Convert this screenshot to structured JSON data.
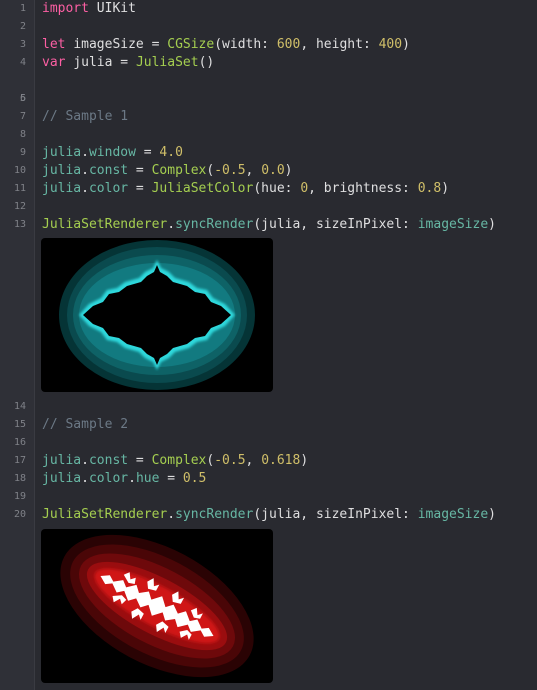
{
  "editor": {
    "lines": [
      {
        "n": "1",
        "top": 0
      },
      {
        "n": "2"
      },
      {
        "n": "3"
      },
      {
        "n": "4"
      },
      {
        "n": "5"
      },
      {
        "n": "6"
      },
      {
        "n": "7"
      },
      {
        "n": "8"
      },
      {
        "n": "9"
      },
      {
        "n": "10"
      },
      {
        "n": "11"
      },
      {
        "n": "12"
      },
      {
        "n": "13"
      },
      {
        "n": "14"
      },
      {
        "n": "15"
      },
      {
        "n": "16"
      },
      {
        "n": "17"
      },
      {
        "n": "18"
      },
      {
        "n": "19"
      },
      {
        "n": "20"
      }
    ]
  },
  "code": {
    "l1": {
      "kw": "import",
      "mod": "UIKit"
    },
    "l3": {
      "kw": "let",
      "name": "imageSize",
      "eq": " = ",
      "type": "CGSize",
      "open": "(width: ",
      "w": "600",
      "mid": ", height: ",
      "h": "400",
      "close": ")"
    },
    "l4": {
      "kw": "var",
      "name": "julia",
      "eq": " = ",
      "type": "JuliaSet",
      "paren": "()"
    },
    "l7": {
      "comment": "// Sample 1"
    },
    "l9": {
      "obj": "julia",
      "dot": ".",
      "prop": "window",
      "eq": " = ",
      "val": "4.0"
    },
    "l10": {
      "obj": "julia",
      "dot": ".",
      "prop": "const",
      "eq": " = ",
      "type": "Complex",
      "open": "(",
      "a": "-0.5",
      "sep": ", ",
      "b": "0.0",
      "close": ")"
    },
    "l11": {
      "obj": "julia",
      "dot": ".",
      "prop": "color",
      "eq": " = ",
      "type": "JuliaSetColor",
      "open": "(hue: ",
      "hue": "0",
      "sep": ", brightness: ",
      "br": "0.8",
      "close": ")"
    },
    "l13": {
      "type": "JuliaSetRenderer",
      "dot": ".",
      "method": "syncRender",
      "open": "(julia, sizeInPixel: ",
      "arg": "imageSize",
      "close": ")"
    },
    "l15": {
      "comment": "// Sample 2"
    },
    "l17": {
      "obj": "julia",
      "dot": ".",
      "prop": "const",
      "eq": " = ",
      "type": "Complex",
      "open": "(",
      "a": "-0.5",
      "sep": ", ",
      "b": "0.618",
      "close": ")"
    },
    "l18": {
      "obj": "julia",
      "dot": ".",
      "prop": "color",
      "dot2": ".",
      "prop2": "hue",
      "eq": " = ",
      "val": "0.5"
    },
    "l20": {
      "type": "JuliaSetRenderer",
      "dot": ".",
      "method": "syncRender",
      "open": "(julia, sizeInPixel: ",
      "arg": "imageSize",
      "close": ")"
    }
  },
  "colors": {
    "background": "#292a30",
    "keyword": "#fc5fa3",
    "type": "#a5cf50",
    "number": "#d0bf69",
    "property": "#5dd8ff",
    "comment": "#6c7986",
    "preview1_accent": "#1fc6cc",
    "preview2_accent": "#ff2020"
  },
  "previews": [
    {
      "name": "julia-preview-1",
      "hue": "cyan"
    },
    {
      "name": "julia-preview-2",
      "hue": "red"
    }
  ]
}
